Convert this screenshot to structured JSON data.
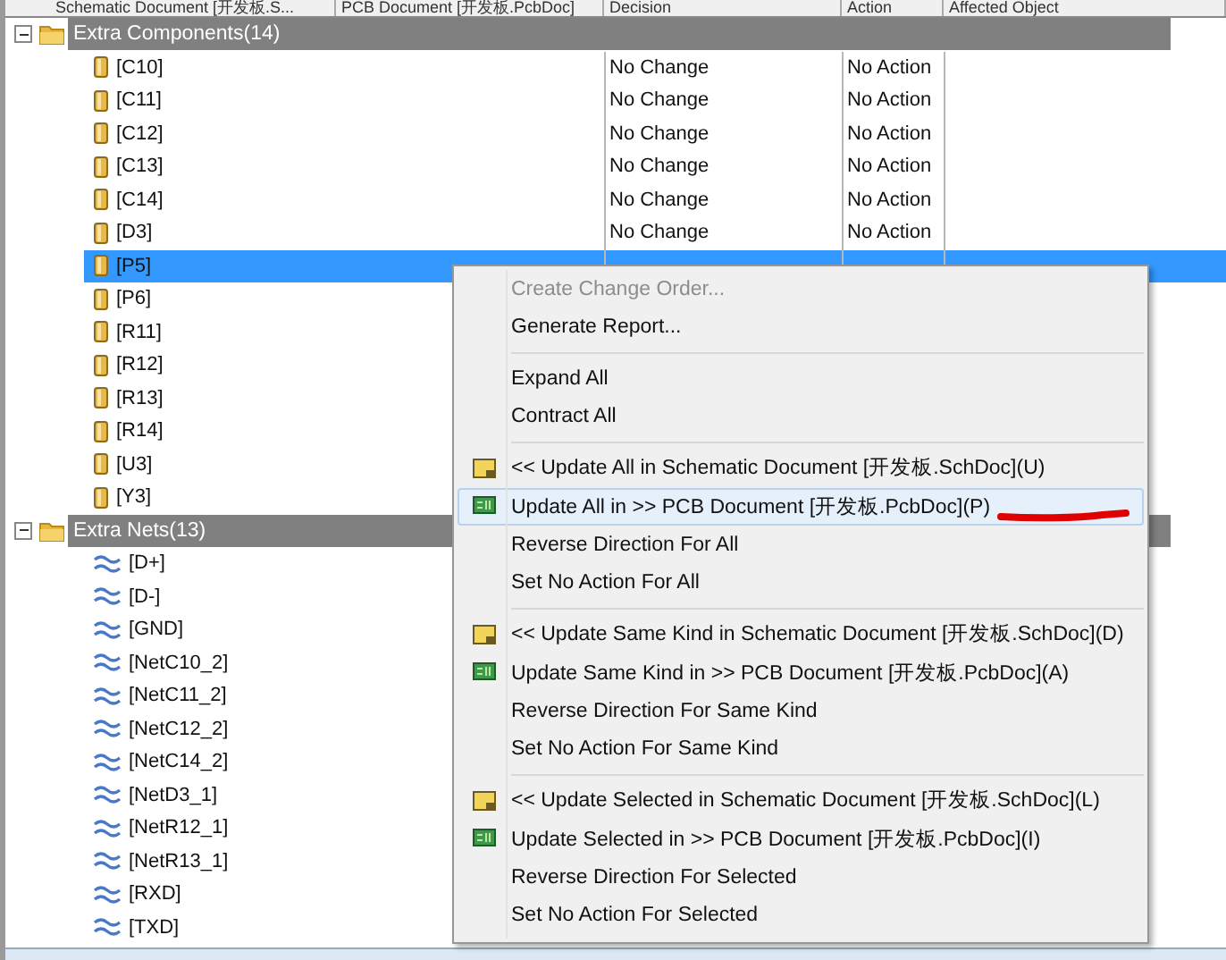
{
  "header": {
    "columns": [
      "Schematic Document [开发板.S...",
      "PCB Document [开发板.PcbDoc]",
      "Decision",
      "Action",
      "Affected Object"
    ]
  },
  "groups": [
    {
      "label": "Extra Components(14)",
      "expanded": true,
      "kind": "component",
      "rows": [
        {
          "name": "[C10]",
          "decision": "No Change",
          "action": "No Action",
          "selected": false
        },
        {
          "name": "[C11]",
          "decision": "No Change",
          "action": "No Action",
          "selected": false
        },
        {
          "name": "[C12]",
          "decision": "No Change",
          "action": "No Action",
          "selected": false
        },
        {
          "name": "[C13]",
          "decision": "No Change",
          "action": "No Action",
          "selected": false
        },
        {
          "name": "[C14]",
          "decision": "No Change",
          "action": "No Action",
          "selected": false
        },
        {
          "name": "[D3]",
          "decision": "No Change",
          "action": "No Action",
          "selected": false
        },
        {
          "name": "[P5]",
          "selected": true
        },
        {
          "name": "[P6]",
          "selected": false
        },
        {
          "name": "[R11]",
          "selected": false
        },
        {
          "name": "[R12]",
          "selected": false
        },
        {
          "name": "[R13]",
          "selected": false
        },
        {
          "name": "[R14]",
          "selected": false
        },
        {
          "name": "[U3]",
          "selected": false
        },
        {
          "name": "[Y3]",
          "selected": false
        }
      ]
    },
    {
      "label": "Extra Nets(13)",
      "expanded": true,
      "kind": "net",
      "rows": [
        {
          "name": "[D+]",
          "selected": false
        },
        {
          "name": "[D-]",
          "selected": false
        },
        {
          "name": "[GND]",
          "selected": false
        },
        {
          "name": "[NetC10_2]",
          "selected": false
        },
        {
          "name": "[NetC11_2]",
          "selected": false
        },
        {
          "name": "[NetC12_2]",
          "selected": false
        },
        {
          "name": "[NetC14_2]",
          "selected": false
        },
        {
          "name": "[NetD3_1]",
          "selected": false
        },
        {
          "name": "[NetR12_1]",
          "selected": false
        },
        {
          "name": "[NetR13_1]",
          "selected": false
        },
        {
          "name": "[RXD]",
          "selected": false
        },
        {
          "name": "[TXD]",
          "selected": false
        }
      ]
    }
  ],
  "context_menu": {
    "items": [
      {
        "kind": "plain",
        "label": "Create Change Order...",
        "disabled": true,
        "highlighted": false
      },
      {
        "kind": "plain",
        "label": "Generate Report...",
        "disabled": false,
        "highlighted": false
      },
      {
        "kind": "separator"
      },
      {
        "kind": "plain",
        "label": "Expand All",
        "disabled": false,
        "highlighted": false
      },
      {
        "kind": "plain",
        "label": "Contract All",
        "disabled": false,
        "highlighted": false
      },
      {
        "kind": "separator"
      },
      {
        "kind": "schematic",
        "label": "<< Update All in Schematic Document [开发板.SchDoc](U)",
        "disabled": false,
        "highlighted": false
      },
      {
        "kind": "pcb",
        "label": "Update All in >> PCB Document [开发板.PcbDoc](P)",
        "disabled": false,
        "highlighted": true
      },
      {
        "kind": "plain",
        "label": "Reverse Direction For All",
        "disabled": false,
        "highlighted": false
      },
      {
        "kind": "plain",
        "label": "Set No Action For All",
        "disabled": false,
        "highlighted": false
      },
      {
        "kind": "separator"
      },
      {
        "kind": "schematic",
        "label": "<< Update Same Kind in Schematic Document [开发板.SchDoc](D)",
        "disabled": false,
        "highlighted": false
      },
      {
        "kind": "pcb",
        "label": "Update Same Kind in >> PCB Document [开发板.PcbDoc](A)",
        "disabled": false,
        "highlighted": false
      },
      {
        "kind": "plain",
        "label": "Reverse Direction For Same Kind",
        "disabled": false,
        "highlighted": false
      },
      {
        "kind": "plain",
        "label": "Set No Action For Same Kind",
        "disabled": false,
        "highlighted": false
      },
      {
        "kind": "separator"
      },
      {
        "kind": "schematic",
        "label": "<< Update Selected in Schematic Document [开发板.SchDoc](L)",
        "disabled": false,
        "highlighted": false
      },
      {
        "kind": "pcb",
        "label": "Update Selected in >> PCB Document [开发板.PcbDoc](I)",
        "disabled": false,
        "highlighted": false
      },
      {
        "kind": "plain",
        "label": "Reverse Direction For Selected",
        "disabled": false,
        "highlighted": false
      },
      {
        "kind": "plain",
        "label": "Set No Action For Selected",
        "disabled": false,
        "highlighted": false
      }
    ]
  }
}
